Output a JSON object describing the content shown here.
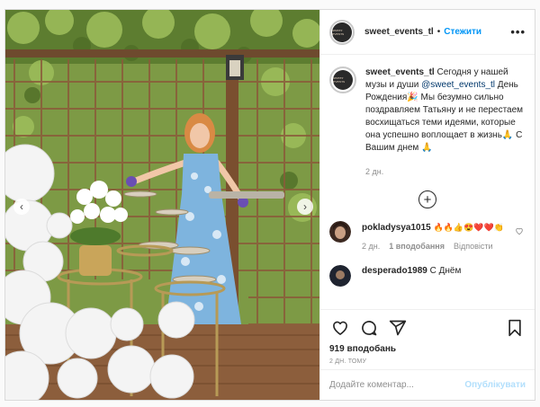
{
  "header": {
    "username": "sweet_events_tl",
    "separator": "•",
    "follow_label": "Стежити",
    "more_label": "•••",
    "avatar_text": "SWEET EVENTS"
  },
  "photo": {
    "prev_label": "‹",
    "next_label": "›"
  },
  "caption": {
    "username": "sweet_events_tl",
    "text_before": "Сегодня у нашей музы и души",
    "mention": "@sweet_events_tl",
    "text_after": "День Рождения🎉 Мы безумно сильно поздравляем Татьяну и не перестаем восхищаться теми идеями, которые она успешно воплощает в жизнь🙏 С Вашим днем 🙏",
    "time": "2 дн."
  },
  "load_more_label": "+",
  "comments": [
    {
      "username": "pokladysya1015",
      "text": "🔥🔥👍😍❤️❤️👏",
      "time": "2 дн.",
      "likes": "1 вподобання",
      "reply": "Відповісти"
    },
    {
      "username": "desperado1989",
      "text": "С Днём"
    }
  ],
  "actions": {
    "like_count": "919 вподобань",
    "post_time": "2 ДН. ТОМУ"
  },
  "comment_box": {
    "placeholder": "Додайте коментар...",
    "publish_label": "Опублікувати"
  },
  "colors": {
    "accent": "#0095f6",
    "publish_disabled": "#b2dffc",
    "mention": "#00376b",
    "muted": "#8e8e8e"
  }
}
